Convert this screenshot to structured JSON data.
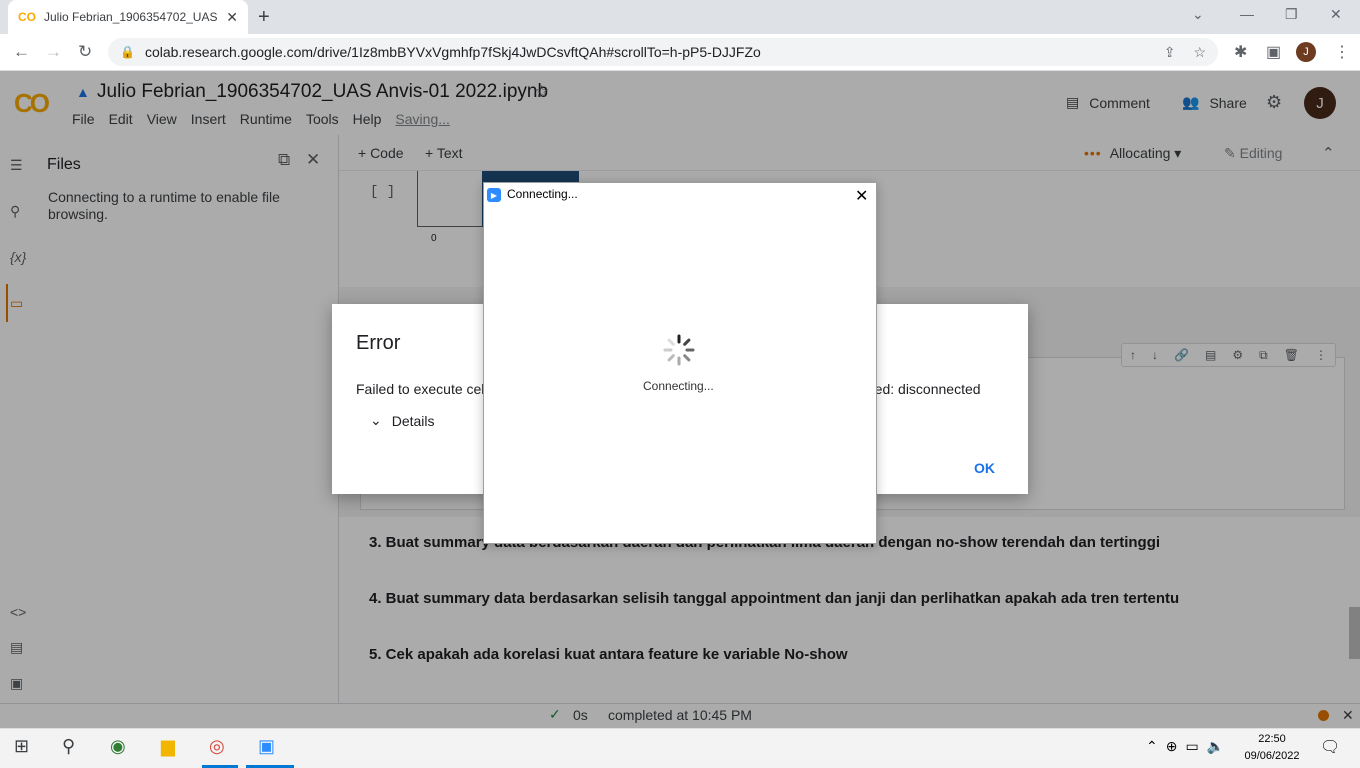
{
  "browser": {
    "tab_title": "Julio Febrian_1906354702_UAS A",
    "tab_favicon": "CO",
    "url": "colab.research.google.com/drive/1Iz8mbBYVxVgmhfp7fSkj4JwDCsvftQAh#scrollTo=h-pP5-DJJFZo",
    "profile_initial": "J"
  },
  "colab": {
    "logo": "CO",
    "notebook_title": "Julio Febrian_1906354702_UAS Anvis-01 2022.ipynb",
    "menu": [
      "File",
      "Edit",
      "View",
      "Insert",
      "Runtime",
      "Tools",
      "Help"
    ],
    "saving": "Saving...",
    "comment_label": "Comment",
    "share_label": "Share",
    "avatar_initial": "J",
    "add_code": "+ Code",
    "add_text": "+ Text",
    "runtime_status": "Allocating",
    "editing_label": "Editing"
  },
  "files_panel": {
    "title": "Files",
    "message": "Connecting to a runtime to enable file browsing."
  },
  "notebook": {
    "cell_bracket": "[ ]",
    "plot_tick": "0",
    "markdown": [
      "3. Buat summary data berdasarkan daerah dan perlihatkan lima daerah dengan no-show terendah dan tertinggi",
      "4. Buat summary data berdasarkan selisih tanggal appointment dan janji dan perlihatkan apakah ada tren tertentu",
      "5. Cek apakah ada korelasi kuat antara feature ke variable No-show"
    ]
  },
  "status_bar": {
    "duration": "0s",
    "completed": "completed at 10:45 PM"
  },
  "error_dialog": {
    "title": "Error",
    "message_left": "Failed to execute cel",
    "message_right": "ected: disconnected",
    "details_label": "Details",
    "ok_label": "OK"
  },
  "zoom_window": {
    "title": "Connecting...",
    "message": "Connecting..."
  },
  "taskbar": {
    "time": "22:50",
    "date": "09/06/2022"
  },
  "colors": {
    "colab_orange": "#f9ab00",
    "link_blue": "#1a73e8",
    "zoom_blue": "#2d8cff",
    "status_orange": "#e37400"
  }
}
